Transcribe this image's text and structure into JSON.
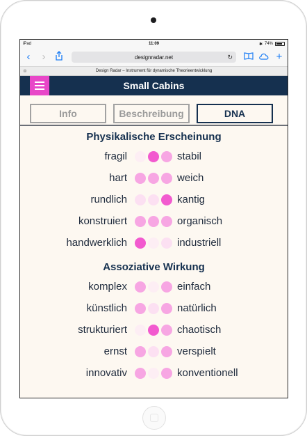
{
  "status": {
    "device": "iPad",
    "time": "11:09",
    "battery": "74%"
  },
  "browser": {
    "url": "designradar.net",
    "page_title": "Design Radar – Instrument für dynamische Theorieentwicklung"
  },
  "app": {
    "title": "Small Cabins"
  },
  "tabs": [
    {
      "label": "Info",
      "active": false
    },
    {
      "label": "Beschreibung",
      "active": false
    },
    {
      "label": "DNA",
      "active": true
    }
  ],
  "colors": {
    "dark": "#15304f",
    "accent": "#e847c8",
    "dot_strong": "#f25acf",
    "dot_mid": "#f7a6e3",
    "dot_light": "#fce0f2",
    "dot_faint": "#fdeef4"
  },
  "sections": [
    {
      "title": "Physikalische Erscheinung",
      "rows": [
        {
          "left": "fragil",
          "right": "stabil",
          "dots": [
            "faint",
            "strong",
            "mid"
          ]
        },
        {
          "left": "hart",
          "right": "weich",
          "dots": [
            "mid",
            "mid",
            "mid"
          ]
        },
        {
          "left": "rundlich",
          "right": "kantig",
          "dots": [
            "light",
            "light",
            "strong"
          ]
        },
        {
          "left": "konstruiert",
          "right": "organisch",
          "dots": [
            "mid",
            "mid",
            "mid"
          ]
        },
        {
          "left": "handwerklich",
          "right": "industriell",
          "dots": [
            "strong",
            "faint",
            "light"
          ]
        }
      ]
    },
    {
      "title": "Assoziative Wirkung",
      "rows": [
        {
          "left": "komplex",
          "right": "einfach",
          "dots": [
            "mid",
            "faint",
            "mid"
          ]
        },
        {
          "left": "künstlich",
          "right": "natürlich",
          "dots": [
            "mid",
            "light",
            "mid"
          ]
        },
        {
          "left": "strukturiert",
          "right": "chaotisch",
          "dots": [
            "faint",
            "strong",
            "mid"
          ]
        },
        {
          "left": "ernst",
          "right": "verspielt",
          "dots": [
            "mid",
            "light",
            "mid"
          ]
        },
        {
          "left": "innovativ",
          "right": "konventionell",
          "dots": [
            "mid",
            "faint",
            "mid"
          ]
        }
      ]
    }
  ]
}
